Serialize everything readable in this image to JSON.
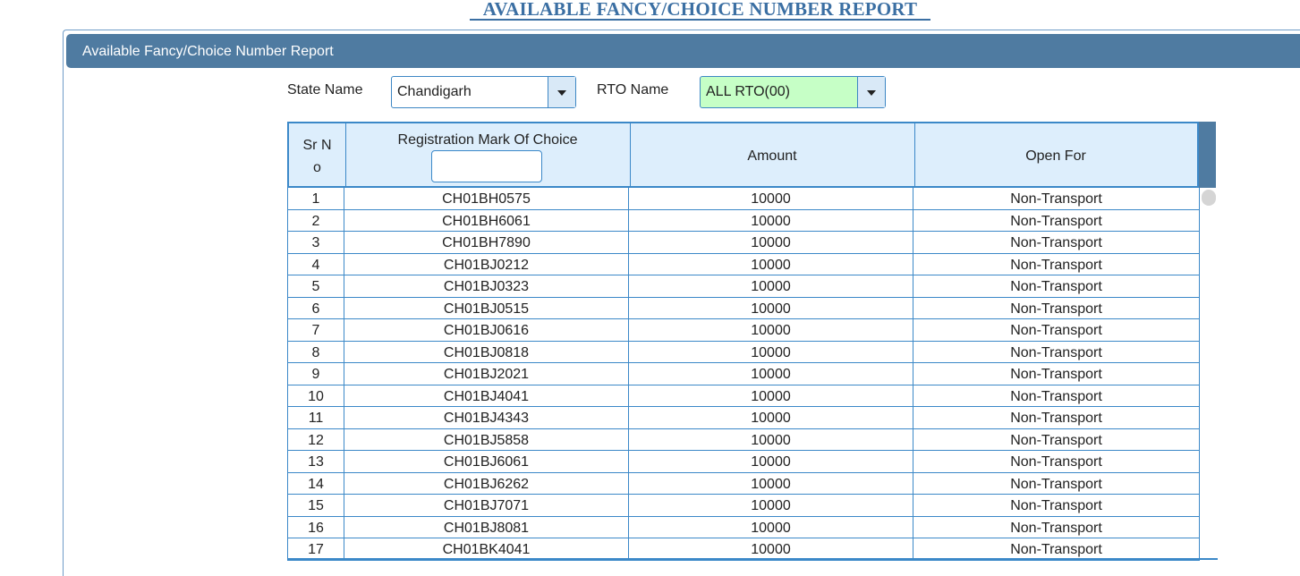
{
  "page": {
    "title": "AVAILABLE FANCY/CHOICE NUMBER REPORT"
  },
  "panel": {
    "title": "Available Fancy/Choice Number Report"
  },
  "filters": {
    "state_label": "State Name",
    "state_value": "Chandigarh",
    "rto_label": "RTO Name",
    "rto_value": "ALL RTO(00)"
  },
  "table": {
    "headers": {
      "sr_no_line1": "Sr N",
      "sr_no_line2": "o",
      "reg_mark": "Registration Mark Of Choice",
      "amount": "Amount",
      "open_for": "Open For"
    },
    "filter_value": "",
    "rows": [
      {
        "sr": "1",
        "reg": "CH01BH0575",
        "amount": "10000",
        "open_for": "Non-Transport"
      },
      {
        "sr": "2",
        "reg": "CH01BH6061",
        "amount": "10000",
        "open_for": "Non-Transport"
      },
      {
        "sr": "3",
        "reg": "CH01BH7890",
        "amount": "10000",
        "open_for": "Non-Transport"
      },
      {
        "sr": "4",
        "reg": "CH01BJ0212",
        "amount": "10000",
        "open_for": "Non-Transport"
      },
      {
        "sr": "5",
        "reg": "CH01BJ0323",
        "amount": "10000",
        "open_for": "Non-Transport"
      },
      {
        "sr": "6",
        "reg": "CH01BJ0515",
        "amount": "10000",
        "open_for": "Non-Transport"
      },
      {
        "sr": "7",
        "reg": "CH01BJ0616",
        "amount": "10000",
        "open_for": "Non-Transport"
      },
      {
        "sr": "8",
        "reg": "CH01BJ0818",
        "amount": "10000",
        "open_for": "Non-Transport"
      },
      {
        "sr": "9",
        "reg": "CH01BJ2021",
        "amount": "10000",
        "open_for": "Non-Transport"
      },
      {
        "sr": "10",
        "reg": "CH01BJ4041",
        "amount": "10000",
        "open_for": "Non-Transport"
      },
      {
        "sr": "11",
        "reg": "CH01BJ4343",
        "amount": "10000",
        "open_for": "Non-Transport"
      },
      {
        "sr": "12",
        "reg": "CH01BJ5858",
        "amount": "10000",
        "open_for": "Non-Transport"
      },
      {
        "sr": "13",
        "reg": "CH01BJ6061",
        "amount": "10000",
        "open_for": "Non-Transport"
      },
      {
        "sr": "14",
        "reg": "CH01BJ6262",
        "amount": "10000",
        "open_for": "Non-Transport"
      },
      {
        "sr": "15",
        "reg": "CH01BJ7071",
        "amount": "10000",
        "open_for": "Non-Transport"
      },
      {
        "sr": "16",
        "reg": "CH01BJ8081",
        "amount": "10000",
        "open_for": "Non-Transport"
      },
      {
        "sr": "17",
        "reg": "CH01BK4041",
        "amount": "10000",
        "open_for": "Non-Transport"
      }
    ]
  },
  "colors": {
    "header_bar": "#4f7ba1",
    "accent": "#3b88c8",
    "rto_select_bg": "#c6ffc6",
    "title": "#3b6fa3"
  },
  "icons": {
    "dropdown": "chevron-down-icon"
  }
}
